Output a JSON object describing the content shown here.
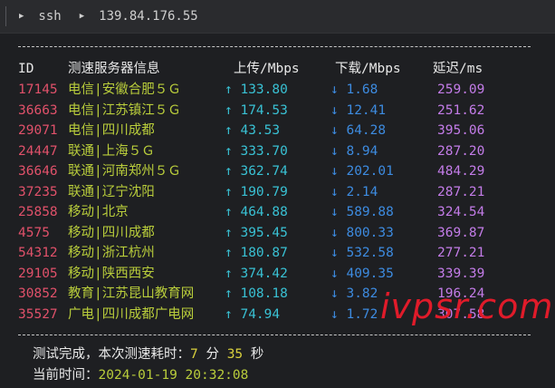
{
  "tab": {
    "session_label": "ssh",
    "host": "139.84.176.55"
  },
  "header": {
    "id": "ID",
    "node": "测速服务器信息",
    "up": "上传/Mbps",
    "down": "下载/Mbps",
    "latency": "延迟/ms"
  },
  "rows": [
    {
      "id": "17145",
      "node": "电信|安徽合肥５Ｇ",
      "up": "↑ 133.80",
      "down": "↓ 1.68",
      "latency": "259.09"
    },
    {
      "id": "36663",
      "node": "电信|江苏镇江５Ｇ",
      "up": "↑ 174.53",
      "down": "↓ 12.41",
      "latency": "251.62"
    },
    {
      "id": "29071",
      "node": "电信|四川成都",
      "up": "↑ 43.53",
      "down": "↓ 64.28",
      "latency": "395.06"
    },
    {
      "id": "24447",
      "node": "联通|上海５Ｇ",
      "up": "↑ 333.70",
      "down": "↓ 8.94",
      "latency": "287.20"
    },
    {
      "id": "36646",
      "node": "联通|河南郑州５Ｇ",
      "up": "↑ 362.74",
      "down": "↓ 202.01",
      "latency": "484.29"
    },
    {
      "id": "37235",
      "node": "联通|辽宁沈阳",
      "up": "↑ 190.79",
      "down": "↓ 2.14",
      "latency": "287.21"
    },
    {
      "id": "25858",
      "node": "移动|北京",
      "up": "↑ 464.88",
      "down": "↓ 589.88",
      "latency": "324.54"
    },
    {
      "id": "4575",
      "node": "移动|四川成都",
      "up": "↑ 395.45",
      "down": "↓ 800.33",
      "latency": "369.87"
    },
    {
      "id": "54312",
      "node": "移动|浙江杭州",
      "up": "↑ 180.87",
      "down": "↓ 532.58",
      "latency": "277.21"
    },
    {
      "id": "29105",
      "node": "移动|陕西西安",
      "up": "↑ 374.42",
      "down": "↓ 409.35",
      "latency": "339.39"
    },
    {
      "id": "30852",
      "node": "教育|江苏昆山教育网",
      "up": "↑ 108.18",
      "down": "↓ 3.82",
      "latency": "196.24"
    },
    {
      "id": "35527",
      "node": "广电|四川成都广电网",
      "up": "↑ 74.94",
      "down": "↓ 1.72",
      "latency": "307.58"
    }
  ],
  "summary": {
    "done_prefix": "测试完成，本次测速耗时：",
    "minutes": "7",
    "min_unit": " 分 ",
    "seconds": "35",
    "sec_unit": " 秒",
    "time_label": "当前时间：",
    "timestamp": "2024-01-19 20:32:08"
  },
  "watermark": "ivpsr.com",
  "colors": {
    "id": "#e0516a",
    "node": "#b9cd3b",
    "upload": "#39c1d4",
    "download": "#3d8be0",
    "latency": "#c37ce8",
    "watermark": "#e01b2a"
  }
}
